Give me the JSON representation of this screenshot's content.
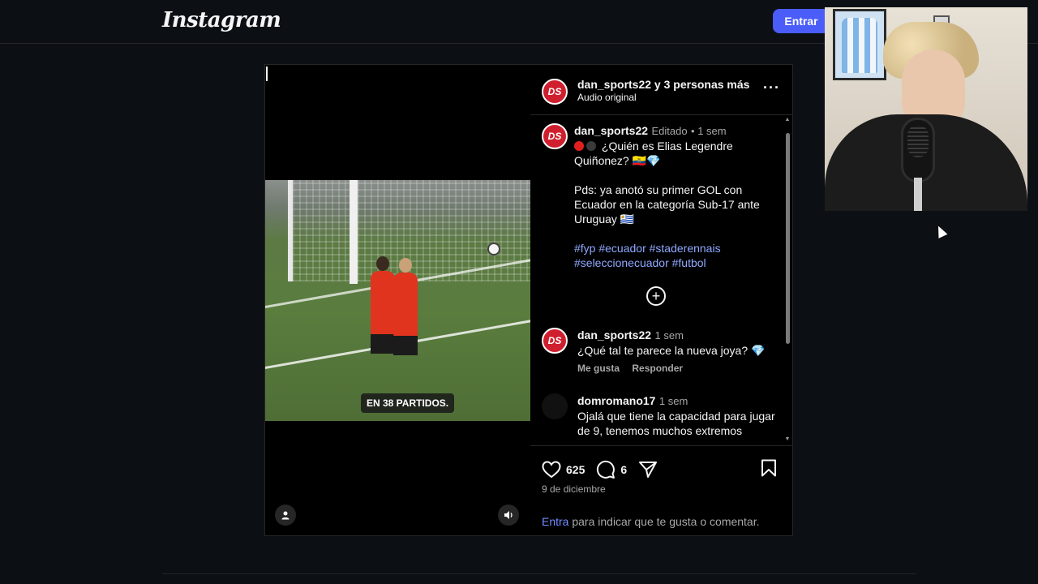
{
  "header": {
    "logo": "Instagram",
    "login_button": "Entrar"
  },
  "post": {
    "video_overlay_text": "EN 38 PARTIDOS.",
    "author_header": "dan_sports22 y 3 personas más",
    "audio": "Audio original",
    "avatar_initials": "DS",
    "caption": {
      "username": "dan_sports22",
      "edited": "Editado",
      "time": "1 sem",
      "line1": "¿Quién es Elias Legendre Quiñonez? 🇪🇨💎",
      "line2": "Pds: ya anotó su primer GOL con Ecuador en la categoría Sub-17 ante Uruguay 🇺🇾",
      "hashtags": "#fyp #ecuador #staderennais #seleccionecuador #futbol"
    },
    "comments": [
      {
        "username": "dan_sports22",
        "time": "1 sem",
        "text": "¿Qué tal te parece la nueva joya? 💎",
        "like_label": "Me gusta",
        "reply_label": "Responder"
      },
      {
        "username": "domromano17",
        "time": "1 sem",
        "text": "Ojalá que tiene la capacidad para jugar de 9, tenemos muchos extremos"
      }
    ],
    "likes": "625",
    "comment_count": "6",
    "date": "9 de diciembre",
    "login_prompt_link": "Entra",
    "login_prompt_text": " para indicar que te gusta o comentar."
  },
  "icons": {
    "like": "heart-icon",
    "comment": "comment-icon",
    "share": "share-icon",
    "save": "bookmark-icon",
    "more": "more-icon",
    "add": "plus-circle-icon",
    "audio": "speaker-icon",
    "tags": "user-tag-icon"
  },
  "colors": {
    "background": "#0c1014",
    "accent": "#4a5df9",
    "hashtag": "#8fa8ff",
    "avatar": "#cf1f2e"
  }
}
